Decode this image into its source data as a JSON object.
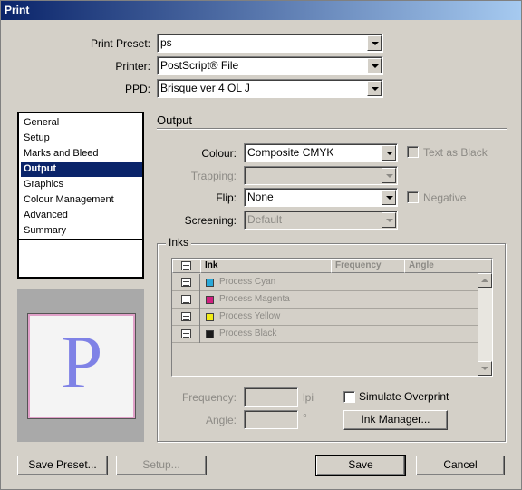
{
  "window": {
    "title": "Print"
  },
  "top": {
    "preset_label": "Print Preset:",
    "preset_value": "ps",
    "printer_label": "Printer:",
    "printer_value": "PostScript® File",
    "ppd_label": "PPD:",
    "ppd_value": "Brisque ver 4 OL J"
  },
  "nav": {
    "items": [
      {
        "label": "General"
      },
      {
        "label": "Setup"
      },
      {
        "label": "Marks and Bleed"
      },
      {
        "label": "Output"
      },
      {
        "label": "Graphics"
      },
      {
        "label": "Colour Management"
      },
      {
        "label": "Advanced"
      },
      {
        "label": "Summary"
      }
    ],
    "selected": "Output"
  },
  "output": {
    "title": "Output",
    "colour_label": "Colour:",
    "colour_value": "Composite CMYK",
    "text_as_black_label": "Text as Black",
    "trapping_label": "Trapping:",
    "trapping_value": "",
    "flip_label": "Flip:",
    "flip_value": "None",
    "negative_label": "Negative",
    "screening_label": "Screening:",
    "screening_value": "Default"
  },
  "inks": {
    "group_title": "Inks",
    "headers": [
      "Ink",
      "Frequency",
      "Angle"
    ],
    "rows": [
      {
        "name": "Process Cyan",
        "color": "#2aa8d8"
      },
      {
        "name": "Process Magenta",
        "color": "#d0207f"
      },
      {
        "name": "Process Yellow",
        "color": "#f2ec16"
      },
      {
        "name": "Process Black",
        "color": "#1a1a1a"
      }
    ],
    "frequency_label": "Frequency:",
    "frequency_unit": "lpi",
    "angle_label": "Angle:",
    "angle_unit": "°",
    "simulate_overprint_label": "Simulate Overprint",
    "ink_manager_label": "Ink Manager..."
  },
  "preview": {
    "letter": "P"
  },
  "buttons": {
    "save_preset": "Save Preset...",
    "setup": "Setup...",
    "save": "Save",
    "cancel": "Cancel"
  }
}
